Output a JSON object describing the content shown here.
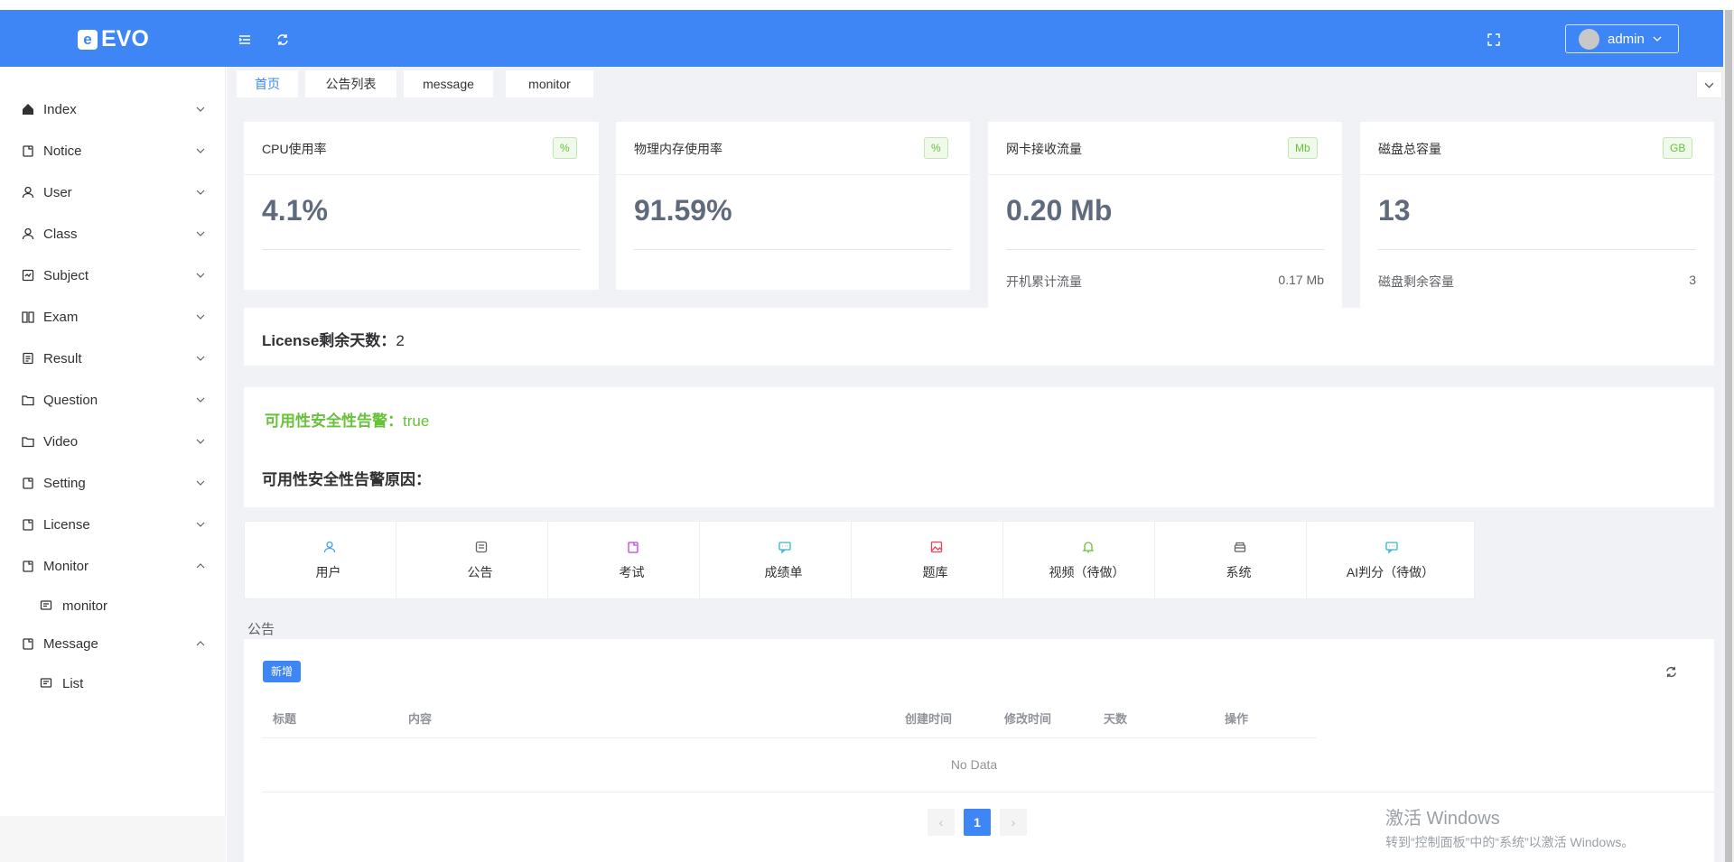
{
  "app": {
    "logo_text": "EVO",
    "logo_mark": "e",
    "user": "admin"
  },
  "colors": {
    "primary": "#3e86f5",
    "success": "#67c23a",
    "header_bg": "#3e86f5"
  },
  "sidebar": {
    "items": [
      {
        "label": "Index",
        "icon": "home-icon",
        "expanded": false
      },
      {
        "label": "Notice",
        "icon": "doc-icon",
        "expanded": false
      },
      {
        "label": "User",
        "icon": "user-icon",
        "expanded": false
      },
      {
        "label": "Class",
        "icon": "user-icon",
        "expanded": false
      },
      {
        "label": "Subject",
        "icon": "chart-icon",
        "expanded": false
      },
      {
        "label": "Exam",
        "icon": "book-icon",
        "expanded": false
      },
      {
        "label": "Result",
        "icon": "list-icon",
        "expanded": false
      },
      {
        "label": "Question",
        "icon": "folder-icon",
        "expanded": false
      },
      {
        "label": "Video",
        "icon": "folder-icon",
        "expanded": false
      },
      {
        "label": "Setting",
        "icon": "doc-icon",
        "expanded": false
      },
      {
        "label": "License",
        "icon": "doc-icon",
        "expanded": false
      },
      {
        "label": "Monitor",
        "icon": "doc-icon",
        "expanded": true
      },
      {
        "label": "monitor",
        "icon": "message-icon",
        "sub": true
      },
      {
        "label": "Message",
        "icon": "doc-icon",
        "expanded": true
      },
      {
        "label": "List",
        "icon": "message-icon",
        "sub": true
      }
    ]
  },
  "tabs": [
    {
      "label": "首页",
      "active": true
    },
    {
      "label": "公告列表"
    },
    {
      "label": "message"
    },
    {
      "label": "monitor"
    }
  ],
  "stats": [
    {
      "title": "CPU使用率",
      "badge": "%",
      "value": "4.1%"
    },
    {
      "title": "物理内存使用率",
      "badge": "%",
      "value": "91.59%"
    },
    {
      "title": "网卡接收流量",
      "badge": "Mb",
      "value": "0.20 Mb",
      "sub_label": "开机累计流量",
      "sub_value": "0.17 Mb"
    },
    {
      "title": "磁盘总容量",
      "badge": "GB",
      "value": "13",
      "sub_label": "磁盘剩余容量",
      "sub_value": "3"
    }
  ],
  "license": {
    "label": "License剩余天数：",
    "value": "2"
  },
  "alert": {
    "label": "可用性安全性告警：",
    "value": "true",
    "reason_label": "可用性安全性告警原因："
  },
  "quick_links": [
    {
      "label": "用户",
      "icon": "user-icon",
      "color": "#409eff"
    },
    {
      "label": "公告",
      "icon": "notice-icon",
      "color": "#606266"
    },
    {
      "label": "考试",
      "icon": "doc-icon",
      "color": "#c040e0"
    },
    {
      "label": "成绩单",
      "icon": "chat-icon",
      "color": "#36b6c4"
    },
    {
      "label": "题库",
      "icon": "picture-icon",
      "color": "#f04060"
    },
    {
      "label": "视频（待做）",
      "icon": "bell-icon",
      "color": "#67c23a"
    },
    {
      "label": "系统",
      "icon": "box-icon",
      "color": "#606266"
    },
    {
      "label": "AI判分（待做）",
      "icon": "chat-icon",
      "color": "#36b6c4"
    }
  ],
  "announcements": {
    "section_title": "公告",
    "new_button": "新增",
    "columns": [
      "标题",
      "内容",
      "创建时间",
      "修改时间",
      "天数",
      "操作"
    ],
    "empty_text": "No Data",
    "pagination": {
      "current": "1",
      "prev": "‹",
      "next": "›"
    }
  },
  "watermark": {
    "line1": "激活 Windows",
    "line2": "转到“控制面板”中的“系统”以激活 Windows。"
  }
}
